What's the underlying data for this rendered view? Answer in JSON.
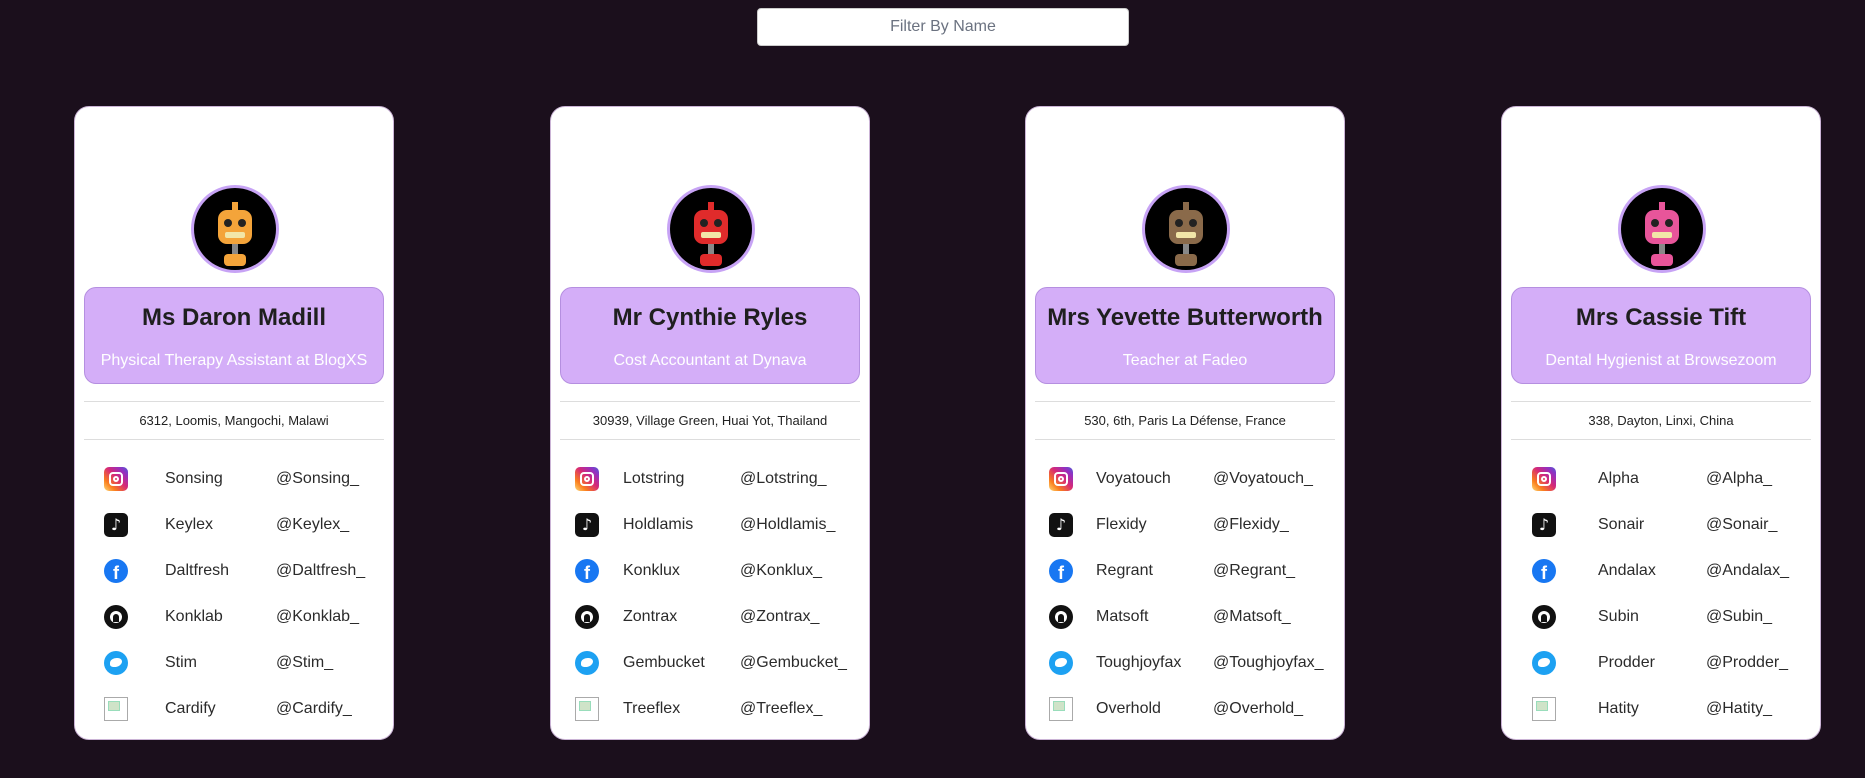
{
  "filter": {
    "placeholder": "Filter By Name"
  },
  "cards": [
    {
      "name": "Ms Daron Madill",
      "job": "Physical Therapy Assistant at BlogXS",
      "address": "6312, Loomis, Mangochi, Malawi",
      "robot_color": "#f4a43a",
      "socials": [
        {
          "network": "instagram",
          "name": "Sonsing",
          "handle": "@Sonsing_"
        },
        {
          "network": "tiktok",
          "name": "Keylex",
          "handle": "@Keylex_"
        },
        {
          "network": "facebook",
          "name": "Daltfresh",
          "handle": "@Daltfresh_"
        },
        {
          "network": "github",
          "name": "Konklab",
          "handle": "@Konklab_"
        },
        {
          "network": "twitter",
          "name": "Stim",
          "handle": "@Stim_"
        },
        {
          "network": "broken-image",
          "name": "Cardify",
          "handle": "@Cardify_"
        }
      ]
    },
    {
      "name": "Mr Cynthie Ryles",
      "job": "Cost Accountant at Dynava",
      "address": "30939, Village Green, Huai Yot, Thailand",
      "robot_color": "#e02b2b",
      "socials": [
        {
          "network": "instagram",
          "name": "Lotstring",
          "handle": "@Lotstring_"
        },
        {
          "network": "tiktok",
          "name": "Holdlamis",
          "handle": "@Holdlamis_"
        },
        {
          "network": "facebook",
          "name": "Konklux",
          "handle": "@Konklux_"
        },
        {
          "network": "github",
          "name": "Zontrax",
          "handle": "@Zontrax_"
        },
        {
          "network": "twitter",
          "name": "Gembucket",
          "handle": "@Gembucket_"
        },
        {
          "network": "broken-image",
          "name": "Treeflex",
          "handle": "@Treeflex_"
        }
      ]
    },
    {
      "name": "Mrs Yevette Butterworth",
      "job": "Teacher at Fadeo",
      "address": "530, 6th, Paris La Défense, France",
      "robot_color": "#8a6a4a",
      "socials": [
        {
          "network": "instagram",
          "name": "Voyatouch",
          "handle": "@Voyatouch_"
        },
        {
          "network": "tiktok",
          "name": "Flexidy",
          "handle": "@Flexidy_"
        },
        {
          "network": "facebook",
          "name": "Regrant",
          "handle": "@Regrant_"
        },
        {
          "network": "github",
          "name": "Matsoft",
          "handle": "@Matsoft_"
        },
        {
          "network": "twitter",
          "name": "Toughjoyfax",
          "handle": "@Toughjoyfax_"
        },
        {
          "network": "broken-image",
          "name": "Overhold",
          "handle": "@Overhold_"
        }
      ]
    },
    {
      "name": "Mrs Cassie Tift",
      "job": "Dental Hygienist at Browsezoom",
      "address": "338, Dayton, Linxi, China",
      "robot_color": "#e8559a",
      "socials": [
        {
          "network": "instagram",
          "name": "Alpha",
          "handle": "@Alpha_"
        },
        {
          "network": "tiktok",
          "name": "Sonair",
          "handle": "@Sonair_"
        },
        {
          "network": "facebook",
          "name": "Andalax",
          "handle": "@Andalax_"
        },
        {
          "network": "github",
          "name": "Subin",
          "handle": "@Subin_"
        },
        {
          "network": "twitter",
          "name": "Prodder",
          "handle": "@Prodder_"
        },
        {
          "network": "broken-image",
          "name": "Hatity",
          "handle": "@Hatity_"
        }
      ]
    }
  ]
}
